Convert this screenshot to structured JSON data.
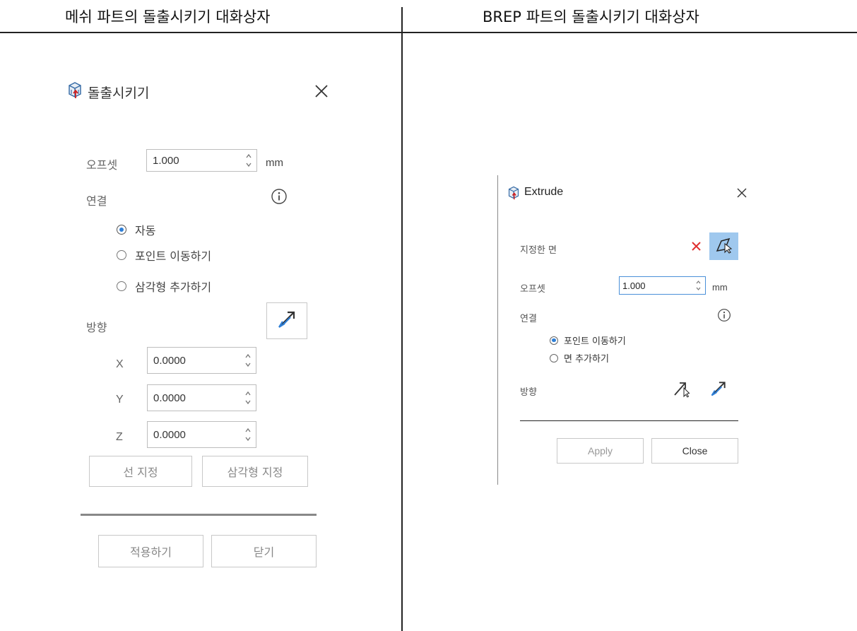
{
  "headers": {
    "left": "메쉬 파트의 돌출시키기 대화상자",
    "right": "BREP 파트의 돌출시키기 대화상자"
  },
  "mesh_dialog": {
    "title": "돌출시키기",
    "offset": {
      "label": "오프셋",
      "value": "1.000",
      "unit": "mm"
    },
    "connection": {
      "label": "연결"
    },
    "radios": [
      {
        "label": "자동",
        "selected": true
      },
      {
        "label": "포인트 이동하기",
        "selected": false
      },
      {
        "label": "삼각형 추가하기",
        "selected": false
      }
    ],
    "direction": {
      "label": "방향"
    },
    "coords": [
      {
        "axis": "X",
        "value": "0.0000"
      },
      {
        "axis": "Y",
        "value": "0.0000"
      },
      {
        "axis": "Z",
        "value": "0.0000"
      }
    ],
    "select_line_label": "선 지정",
    "select_triangle_label": "삼각형 지정",
    "apply_label": "적용하기",
    "close_label": "닫기"
  },
  "brep_dialog": {
    "title": "Extrude",
    "selected_face_label": "지정한 면",
    "offset": {
      "label": "오프셋",
      "value": "1.000",
      "unit": "mm"
    },
    "connection": {
      "label": "연결"
    },
    "radios": [
      {
        "label": "포인트 이동하기",
        "selected": true
      },
      {
        "label": "면 추가하기",
        "selected": false
      }
    ],
    "direction": {
      "label": "방향"
    },
    "apply_label": "Apply",
    "close_label": "Close"
  },
  "colors": {
    "accent": "#2f7fd6",
    "clear_red": "#e03030",
    "select_bg": "#9fc8ee"
  },
  "icons": [
    "extrude-icon",
    "close-icon",
    "info-icon",
    "flip-direction-icon",
    "clear-selection-icon",
    "select-face-icon",
    "pick-direction-icon"
  ]
}
